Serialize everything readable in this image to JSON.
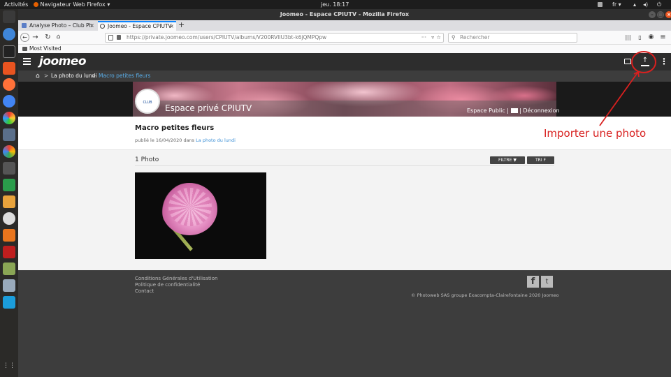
{
  "os": {
    "activities": "Activités",
    "browser_menu": "Navigateur Web Firefox ▾",
    "clock": "jeu. 18:17",
    "lang": "fr ▾"
  },
  "window": {
    "title": "Joomeo - Espace CPIUTV - Mozilla Firefox"
  },
  "tabs": [
    {
      "label": "Analyse Photo – Club Ph",
      "active": false
    },
    {
      "label": "Joomeo - Espace CPIUTV",
      "active": true
    }
  ],
  "nav": {
    "url": "https://private.joomeo.com/users/CPIUTV/albums/V200RVIIU3bt-k6jQMPQpw",
    "search_placeholder": "Rechercher",
    "bookmark": "Most Visited"
  },
  "app": {
    "logo": "joomeo",
    "breadcrumb": [
      "La photo du lundi",
      "Macro petites fleurs"
    ],
    "space_title": "Espace privé CPIUTV",
    "club_logo_text": "CLUB PHOTO",
    "banner_links": {
      "public": "Espace Public",
      "logout": "Déconnexion"
    },
    "album": {
      "title": "Macro petites fleurs",
      "published_prefix": "publié le 16/04/2020 dans",
      "published_link": "La photo du lundi",
      "count": "1 Photo",
      "filter_label": "FILTRE",
      "sort_label": "TRI"
    },
    "footer": {
      "links": [
        "Conditions Générales d'Utilisation",
        "Politique de confidentialité",
        "Contact"
      ],
      "copyright": "© Photoweb SAS groupe Exacompta-Clairefontaine 2020 Joomeo"
    }
  },
  "annotation": {
    "label": "Importer une photo",
    "color": "#d8201f"
  }
}
